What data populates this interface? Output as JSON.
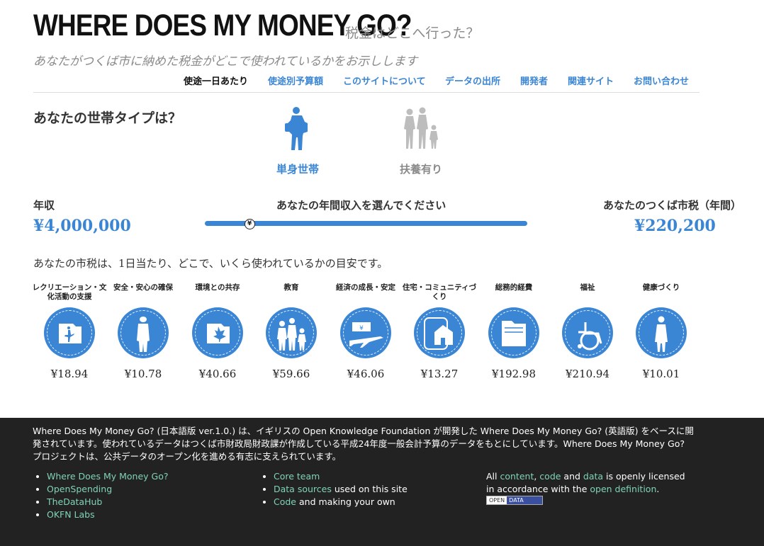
{
  "header": {
    "title": "WHERE DOES MY MONEY GO?",
    "subtitle": "税金はどこへ行った？",
    "tagline": "あなたがつくば市に納めた税金がどこで使われているかをお示しします"
  },
  "nav": {
    "items": [
      {
        "label": "使途一日あたり",
        "active": true
      },
      {
        "label": "使途別予算額"
      },
      {
        "label": "このサイトについて"
      },
      {
        "label": "データの出所"
      },
      {
        "label": "開発者"
      },
      {
        "label": "関連サイト"
      },
      {
        "label": "お問い合わせ"
      }
    ]
  },
  "household": {
    "question": "あなたの世帯タイプは？",
    "options": [
      {
        "label": "単身世帯",
        "icon": "single-person-icon",
        "selected": true
      },
      {
        "label": "扶養有り",
        "icon": "family-icon",
        "selected": false
      }
    ]
  },
  "income": {
    "label": "年収",
    "value": "¥4,000,000",
    "slider_prompt": "あなたの年間収入を選んでください",
    "slider_thumb": "¥",
    "slider_position": 0.14
  },
  "tax": {
    "label": "あなたのつくば市税（年間）",
    "value": "¥220,200"
  },
  "sentence": "あなたの市税は、1日当たり、どこで、いくら使われているかの目安です。",
  "categories": [
    {
      "label": "レクリエーション・文化活動の支援",
      "amount": "¥18.94",
      "icon": "ballet-icon"
    },
    {
      "label": "安全・安心の確保",
      "amount": "¥10.78",
      "icon": "police-icon"
    },
    {
      "label": "環境との共存",
      "amount": "¥40.66",
      "icon": "leaf-icon"
    },
    {
      "label": "教育",
      "amount": "¥59.66",
      "icon": "school-family-icon"
    },
    {
      "label": "経済の成長・安定",
      "amount": "¥46.06",
      "icon": "money-airplane-icon"
    },
    {
      "label": "住宅・コミュニティづくり",
      "amount": "¥13.27",
      "icon": "house-icon"
    },
    {
      "label": "総務的経費",
      "amount": "¥192.98",
      "icon": "folder-icon"
    },
    {
      "label": "福祉",
      "amount": "¥210.94",
      "icon": "wheelchair-icon"
    },
    {
      "label": "健康づくり",
      "amount": "¥10.01",
      "icon": "nurse-icon"
    }
  ],
  "footer": {
    "text": "Where Does My Money Go? (日本語版 ver.1.0.) は、イギリスの Open Knowledge Foundation が開発した Where Does My Money Go? (英語版) をベースに開発されています。使われているデータはつくば市財政局財政課が作成している平成24年度一般会計予算のデータをもとにしています。Where Does My Money Go? プロジェクトは、公共データのオープン化を進める有志に支えられています。",
    "col1": [
      "Where Does My Money Go?",
      "OpenSpending",
      "TheDataHub",
      "OKFN Labs"
    ],
    "col2": [
      {
        "link": "Core team",
        "rest": ""
      },
      {
        "link": "Data sources",
        "rest": " used on this site"
      },
      {
        "link": "Code",
        "rest": " and making your own"
      }
    ],
    "license": {
      "p1": "All ",
      "content": "content",
      "comma": ", ",
      "code": "code",
      "and": " and ",
      "data": "data",
      "p2": " is openly licensed in accordance with the ",
      "open_definition": "open definition",
      "p3": ".",
      "badge_left": "OPEN",
      "badge_right": "DATA"
    }
  }
}
